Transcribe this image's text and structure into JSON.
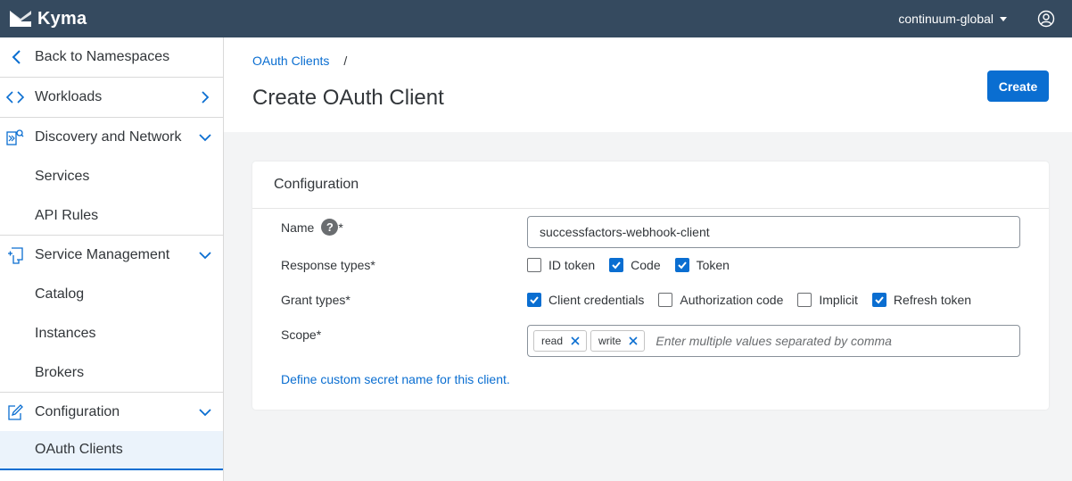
{
  "shell": {
    "app_name": "Kyma",
    "namespace": "continuum-global"
  },
  "sidebar": {
    "back_label": "Back to Namespaces",
    "items": [
      {
        "label": "Workloads",
        "icon": "code-icon",
        "expanded": false
      },
      {
        "label": "Discovery and Network",
        "icon": "network-icon",
        "expanded": true
      },
      {
        "label": "Services",
        "sub": true
      },
      {
        "label": "API Rules",
        "sub": true
      },
      {
        "label": "Service Management",
        "icon": "service-icon",
        "expanded": true
      },
      {
        "label": "Catalog",
        "sub": true
      },
      {
        "label": "Instances",
        "sub": true
      },
      {
        "label": "Brokers",
        "sub": true
      },
      {
        "label": "Configuration",
        "icon": "edit-icon",
        "expanded": true
      },
      {
        "label": "OAuth Clients",
        "sub": true,
        "selected": true
      }
    ]
  },
  "header": {
    "breadcrumb": "OAuth Clients",
    "breadcrumb_sep": "/",
    "title": "Create OAuth Client",
    "create_label": "Create"
  },
  "form": {
    "section_title": "Configuration",
    "name_label": "Name",
    "name_required": "*",
    "help_glyph": "?",
    "name_value": "successfactors-webhook-client",
    "response_label": "Response types*",
    "response_types": [
      {
        "label": "ID token",
        "checked": false
      },
      {
        "label": "Code",
        "checked": true
      },
      {
        "label": "Token",
        "checked": true
      }
    ],
    "grant_label": "Grant types*",
    "grant_types": [
      {
        "label": "Client credentials",
        "checked": true
      },
      {
        "label": "Authorization code",
        "checked": false
      },
      {
        "label": "Implicit",
        "checked": false
      },
      {
        "label": "Refresh token",
        "checked": true
      }
    ],
    "scope_label": "Scope*",
    "scopes": [
      "read",
      "write"
    ],
    "scope_placeholder": "Enter multiple values separated by comma",
    "secret_link": "Define custom secret name for this client."
  },
  "colors": {
    "shell": "#354a5f",
    "accent": "#0a6ed1",
    "selected_bg": "#ebf3fb"
  }
}
